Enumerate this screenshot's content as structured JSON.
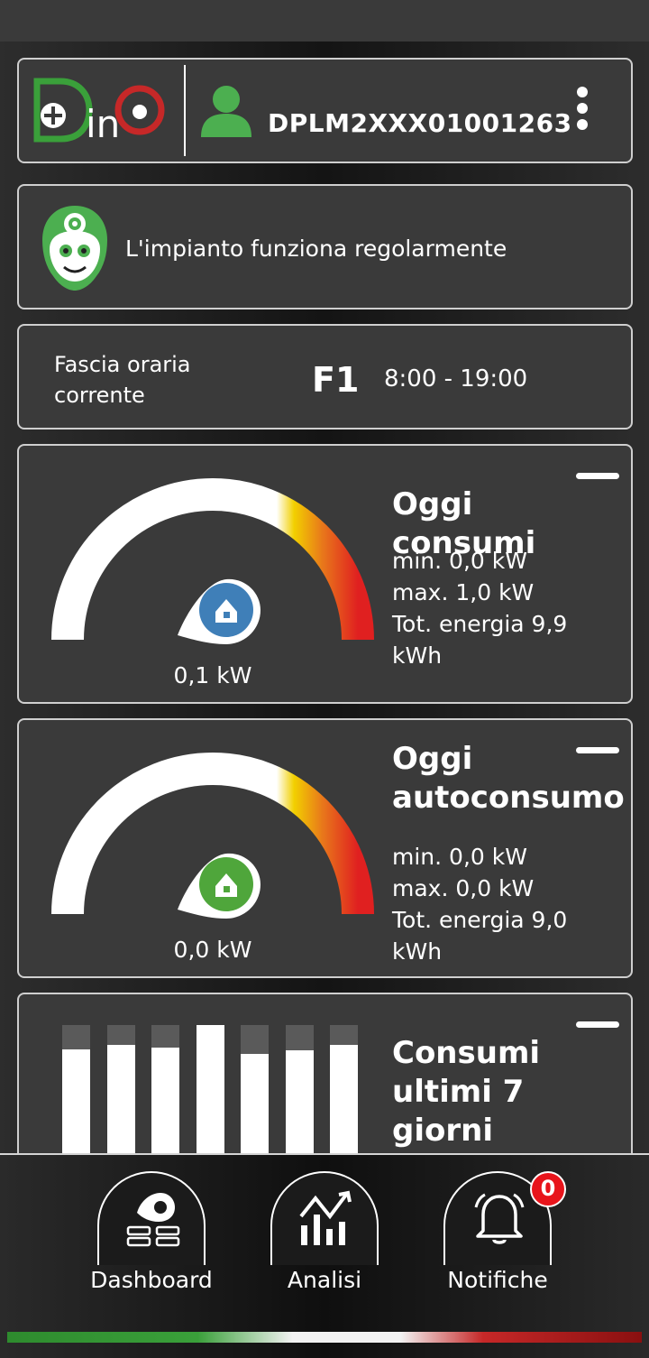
{
  "header": {
    "logo_text": "Dino",
    "device_id": "DPLM2XXX01001263"
  },
  "status": {
    "message": "L'impianto funziona regolarmente"
  },
  "fascia": {
    "label": "Fascia oraria corrente",
    "code": "F1",
    "time": "8:00 - 19:00"
  },
  "consumi": {
    "title": "Oggi consumi",
    "value": "0,1 kW",
    "min": "min. 0,0 kW",
    "max": "max. 1,0 kW",
    "tot": "Tot. energia 9,9 kWh",
    "icon_color": "#3f7fb8"
  },
  "autoconsumo": {
    "title": "Oggi autoconsumo",
    "value": "0,0 kW",
    "min": "min. 0,0 kW",
    "max": "max. 0,0 kW",
    "tot": "Tot. energia 9,0 kWh",
    "icon_color": "#4fa63b"
  },
  "week": {
    "title": "Consumi ultimi 7 giorni",
    "bar_levels": [
      0.84,
      0.87,
      0.85,
      1.0,
      0.81,
      0.83,
      0.87
    ]
  },
  "nav": {
    "items": [
      {
        "label": "Dashboard",
        "icon": "dashboard-icon"
      },
      {
        "label": "Analisi",
        "icon": "analytics-icon"
      },
      {
        "label": "Notifiche",
        "icon": "bell-icon"
      }
    ],
    "notification_count": "0"
  },
  "colors": {
    "accent_green": "#4caf50",
    "alert_red": "#e8141b"
  }
}
